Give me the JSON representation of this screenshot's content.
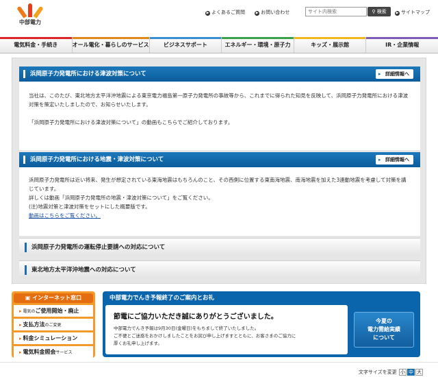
{
  "header": {
    "logo_text": "中部電力",
    "faq": "よくあるご質問",
    "contact": "お問い合わせ",
    "search_placeholder": "サイト内検索",
    "search_button": "検索",
    "sitemap": "サイトマップ"
  },
  "nav": {
    "items": [
      "電気料金・手続き",
      "オール電化・暮らしのサービス",
      "ビジネスサポート",
      "エネルギー・環境・原子力",
      "キッズ・展示館",
      "IR・企業情報"
    ]
  },
  "main": {
    "detail_label": "詳細情報へ",
    "section1": {
      "title": "浜岡原子力発電所における津波対策について",
      "p1": "当社は、このたび、東北地方太平洋沖地震による東京電力福島第一原子力発電所の事故等から、これまでに得られた知見を反映して、浜岡原子力発電所における津波対策を策定いたしましたので、お知らせいたします。",
      "p2": "「浜岡原子力発電所における津波対策について」の動画もこちらでご紹介しております。"
    },
    "section2": {
      "title": "浜岡原子力発電所における地震・津波対策について",
      "p1": "浜岡原子力発電所は近い将来、発生が想定されている東海地震はもちろんのこと、その西側に位置する東南海地震、南海地震を加えた3連動地震を考慮して対策を講じています。",
      "p2": "詳しくは動画「浜岡原子力発電所の地震・津波対策について」をご覧ください。",
      "p3": "(注)地震対策と津波対策をセットにした概要版です。",
      "link": "動画はこちらをご覧ください。"
    },
    "sub1": "浜岡原子力発電所の運転停止要請への対応について",
    "sub2": "東北地方太平洋沖地震への対応について"
  },
  "internet": {
    "title": "インターネット窓口",
    "items": [
      {
        "small": "電気の",
        "label": "ご使用開始・廃止"
      },
      {
        "small": "",
        "label": "支払方法",
        "suffix": "のご変更"
      },
      {
        "small": "",
        "label": "料金シミュレーション"
      },
      {
        "small": "",
        "label": "電気料金照会",
        "suffix": "サービス"
      }
    ]
  },
  "yoho": {
    "title": "中部電力でんき予報終了のご案内とお礼",
    "heading": "節電にご協力いただき誠にありがとうございました。",
    "line1": "中部電力でんき予報は9月30日(金曜日)をもちまして終了いたしました。",
    "line2": "ご不便とご迷惑をおかけしましたことをお詫び申し上げますとともに、お客さまのご協力に",
    "line3": "厚くお礼申し上げます。",
    "button_l1": "今夏の",
    "button_l2": "電力需給実績",
    "button_l3": "について"
  },
  "fontsize": {
    "label": "文字サイズを変更",
    "small": "小",
    "medium": "中",
    "large": "大"
  }
}
